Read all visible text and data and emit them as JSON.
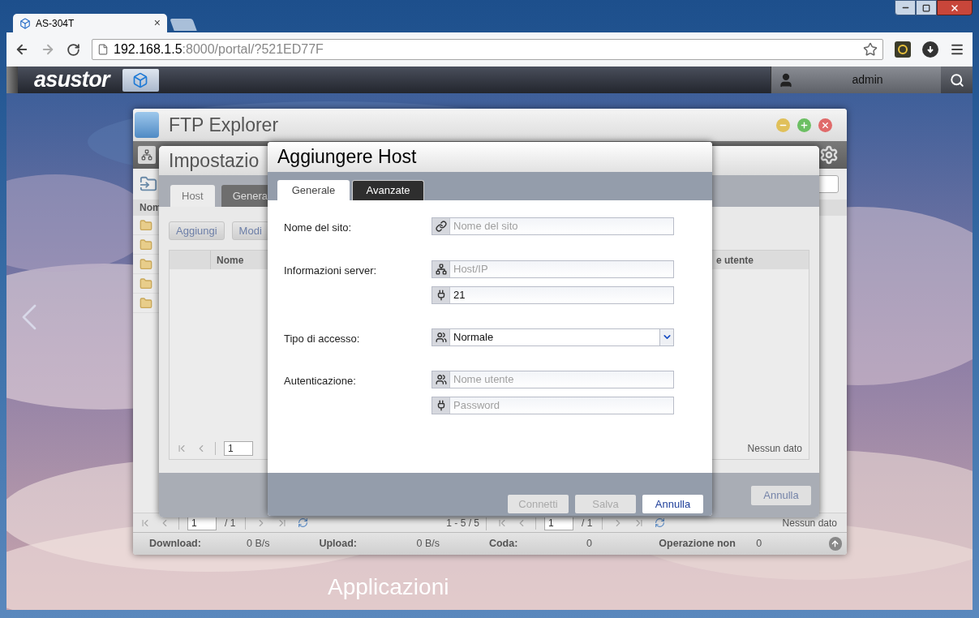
{
  "browser": {
    "tabs": [
      {
        "title": "AS-304T",
        "close": "×",
        "selected": true
      }
    ],
    "url": {
      "host": "192.168.1.5",
      "rest": ":8000/portal/?521ED77F"
    }
  },
  "topbar": {
    "logo": "asustor",
    "user": "admin"
  },
  "desktop": {
    "label": "Applicazioni"
  },
  "ftp_explorer": {
    "title": "FTP Explorer",
    "left_pane": {
      "column": "Nom",
      "folders": [
        {
          "kind": "folder"
        },
        {
          "kind": "folder"
        },
        {
          "kind": "folder"
        },
        {
          "kind": "folder"
        },
        {
          "kind": "folder"
        }
      ]
    },
    "left_pager": {
      "page": "1",
      "total": "/ 1",
      "range": "1 - 5 / 5"
    },
    "right_pager": {
      "page": "1",
      "total": "/ 1",
      "status": "Nessun dato"
    },
    "status_bar": [
      {
        "label": "Download:",
        "value": "0 B/s"
      },
      {
        "label": "Upload:",
        "value": "0 B/s"
      },
      {
        "label": "Coda:",
        "value": "0"
      },
      {
        "label": "Operazione non",
        "value": "0"
      }
    ]
  },
  "settings_window": {
    "title": "Impostazio",
    "tabs": [
      {
        "label": "Host",
        "selected": true
      },
      {
        "label": "Genera",
        "selected": false
      }
    ],
    "buttons": [
      {
        "label": "Aggiungi"
      },
      {
        "label": "Modi"
      }
    ],
    "columns": [
      "Nome",
      "e utente"
    ],
    "pager": {
      "page": "1",
      "status": "Nessun dato"
    },
    "footer_button": "Annulla"
  },
  "dialog": {
    "title": "Aggiungere Host",
    "tabs": [
      {
        "label": "Generale",
        "selected": true
      },
      {
        "label": "Avanzate",
        "selected": false
      }
    ],
    "rows": [
      {
        "label": "Nome del sito:",
        "fields": [
          {
            "kind": "text",
            "placeholder": "Nome del sito"
          }
        ]
      },
      {
        "label": "Informazioni server:",
        "fields": [
          {
            "kind": "text",
            "placeholder": "Host/IP"
          },
          {
            "kind": "text",
            "value": "21"
          }
        ]
      },
      {
        "label": "Tipo di accesso:",
        "fields": [
          {
            "kind": "select",
            "value": "Normale"
          }
        ]
      },
      {
        "label": "Autenticazione:",
        "fields": [
          {
            "kind": "text",
            "placeholder": "Nome utente"
          },
          {
            "kind": "text",
            "placeholder": "Password"
          }
        ]
      }
    ],
    "buttons": [
      {
        "label": "Connetti",
        "disabled": true
      },
      {
        "label": "Salva",
        "disabled": true
      },
      {
        "label": "Annulla",
        "disabled": false
      }
    ]
  }
}
